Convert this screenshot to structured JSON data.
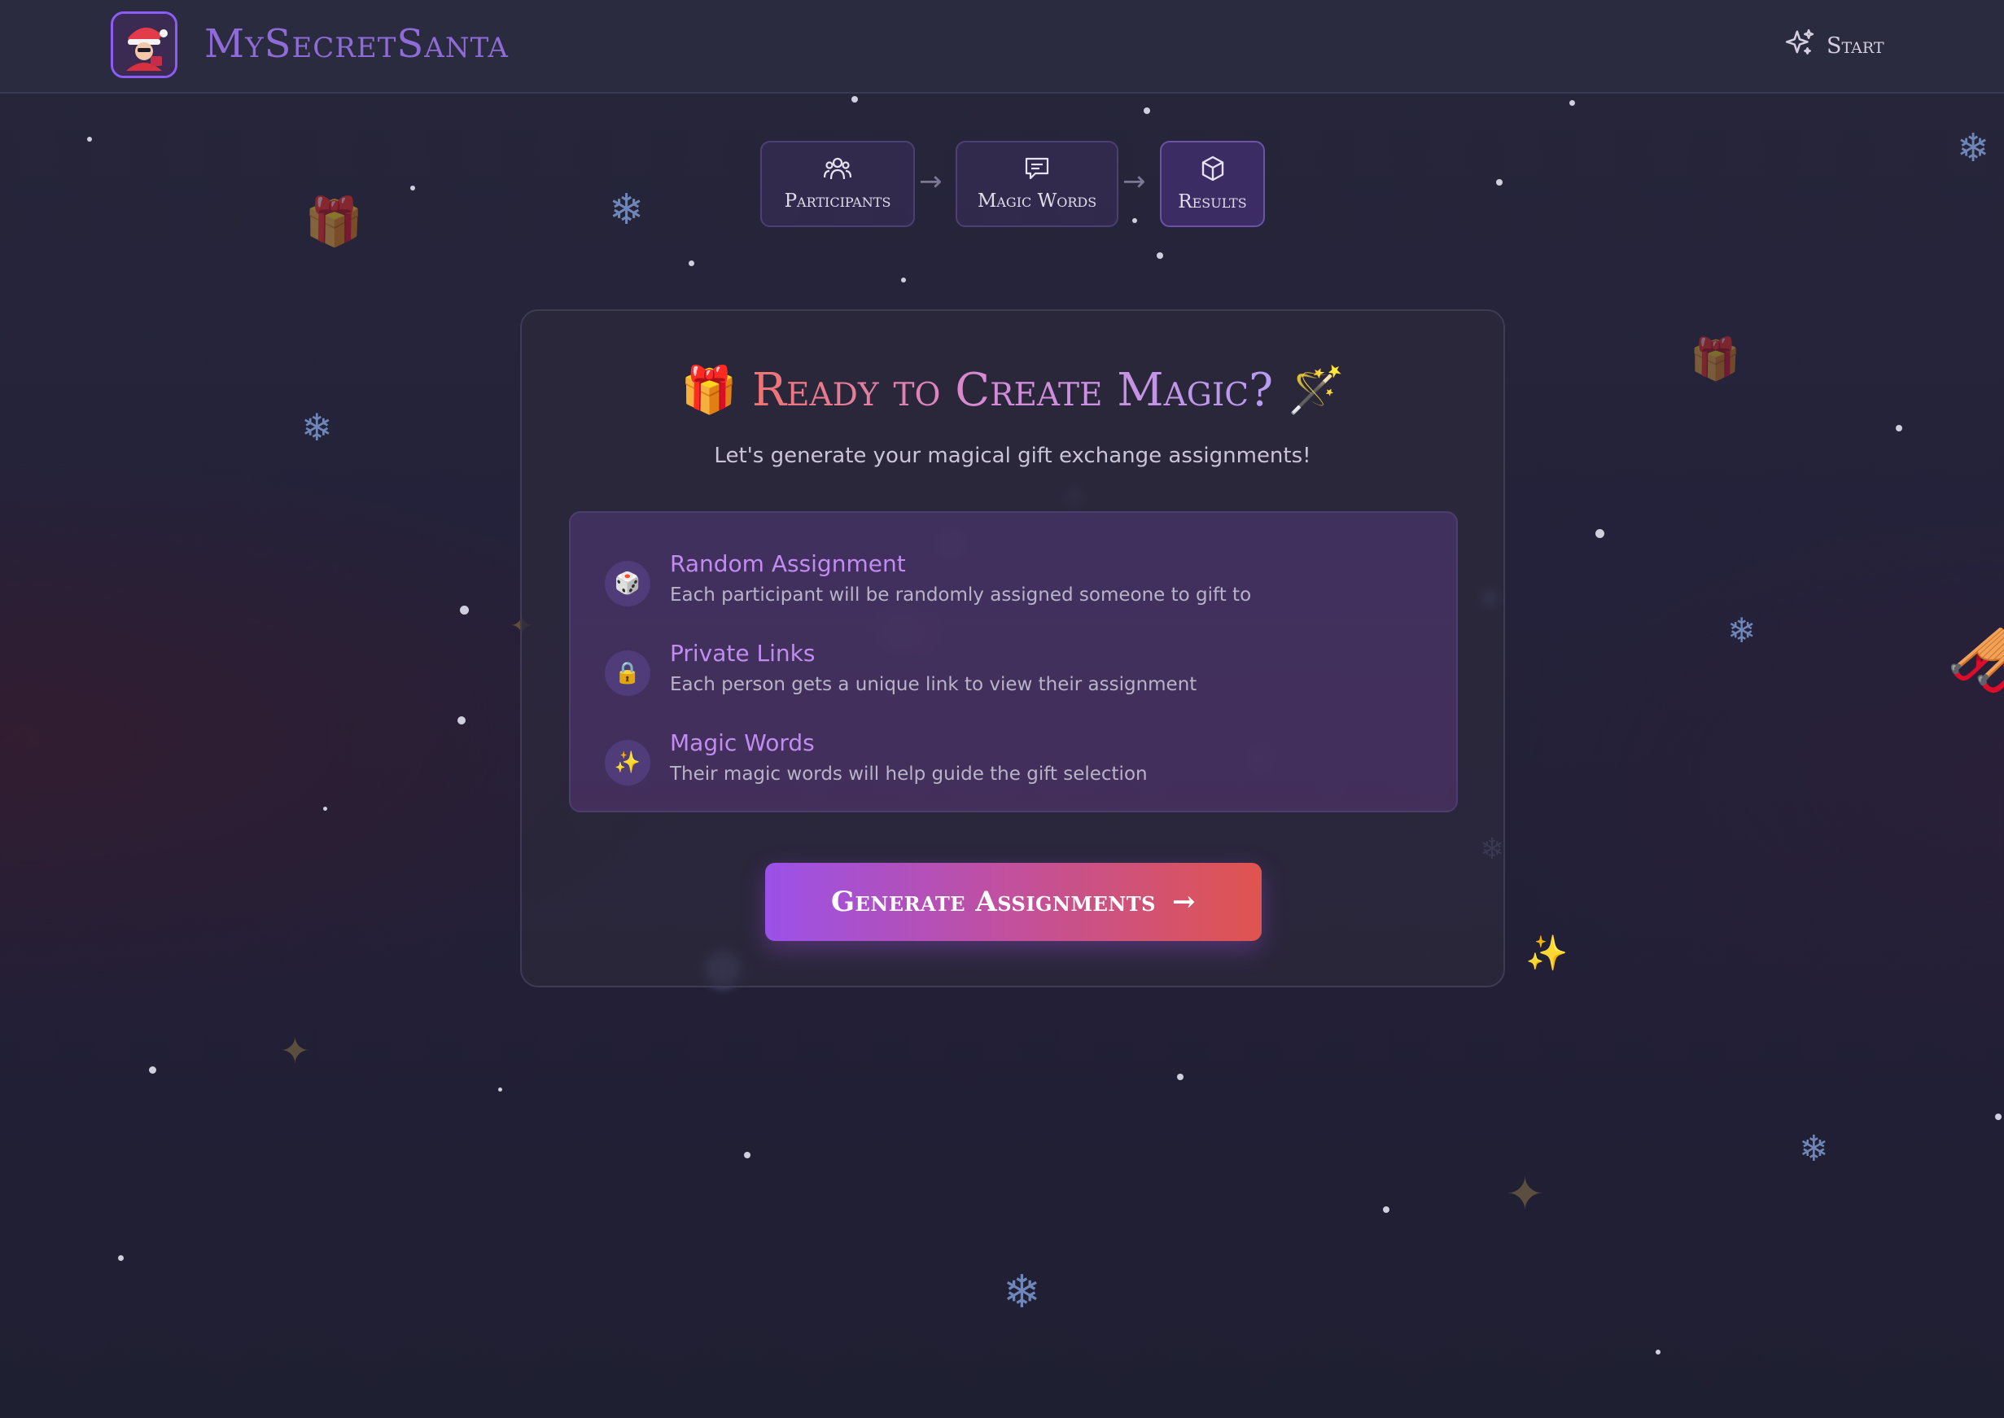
{
  "header": {
    "brand_name": "MySecretSanta",
    "start_label": "Start",
    "logo_icon": "santa-logo-icon",
    "start_icon": "sparkles-icon"
  },
  "stepper": {
    "steps": [
      {
        "label": "Participants",
        "icon": "users-icon"
      },
      {
        "label": "Magic Words",
        "icon": "message-icon"
      },
      {
        "label": "Results",
        "icon": "box-icon",
        "active": true
      }
    ],
    "separator": "→"
  },
  "card": {
    "title_emoji_left": "🎁",
    "title": "Ready to Create Magic?",
    "title_emoji_right": "🪄",
    "subtitle": "Let's generate your magical gift exchange assignments!",
    "features": [
      {
        "icon": "🎲",
        "title": "Random Assignment",
        "description": "Each participant will be randomly assigned someone to gift to"
      },
      {
        "icon": "🔒",
        "title": "Private Links",
        "description": "Each person gets a unique link to view their assignment"
      },
      {
        "icon": "✨",
        "title": "Magic Words",
        "description": "Their magic words will help guide the gift selection"
      }
    ],
    "generate_label": "Generate Assignments",
    "generate_arrow": "→"
  },
  "theme": {
    "accent": "#8b5cf6",
    "button_gradient": [
      "#9b51e8",
      "#e0544f"
    ],
    "background": "#24223a"
  }
}
